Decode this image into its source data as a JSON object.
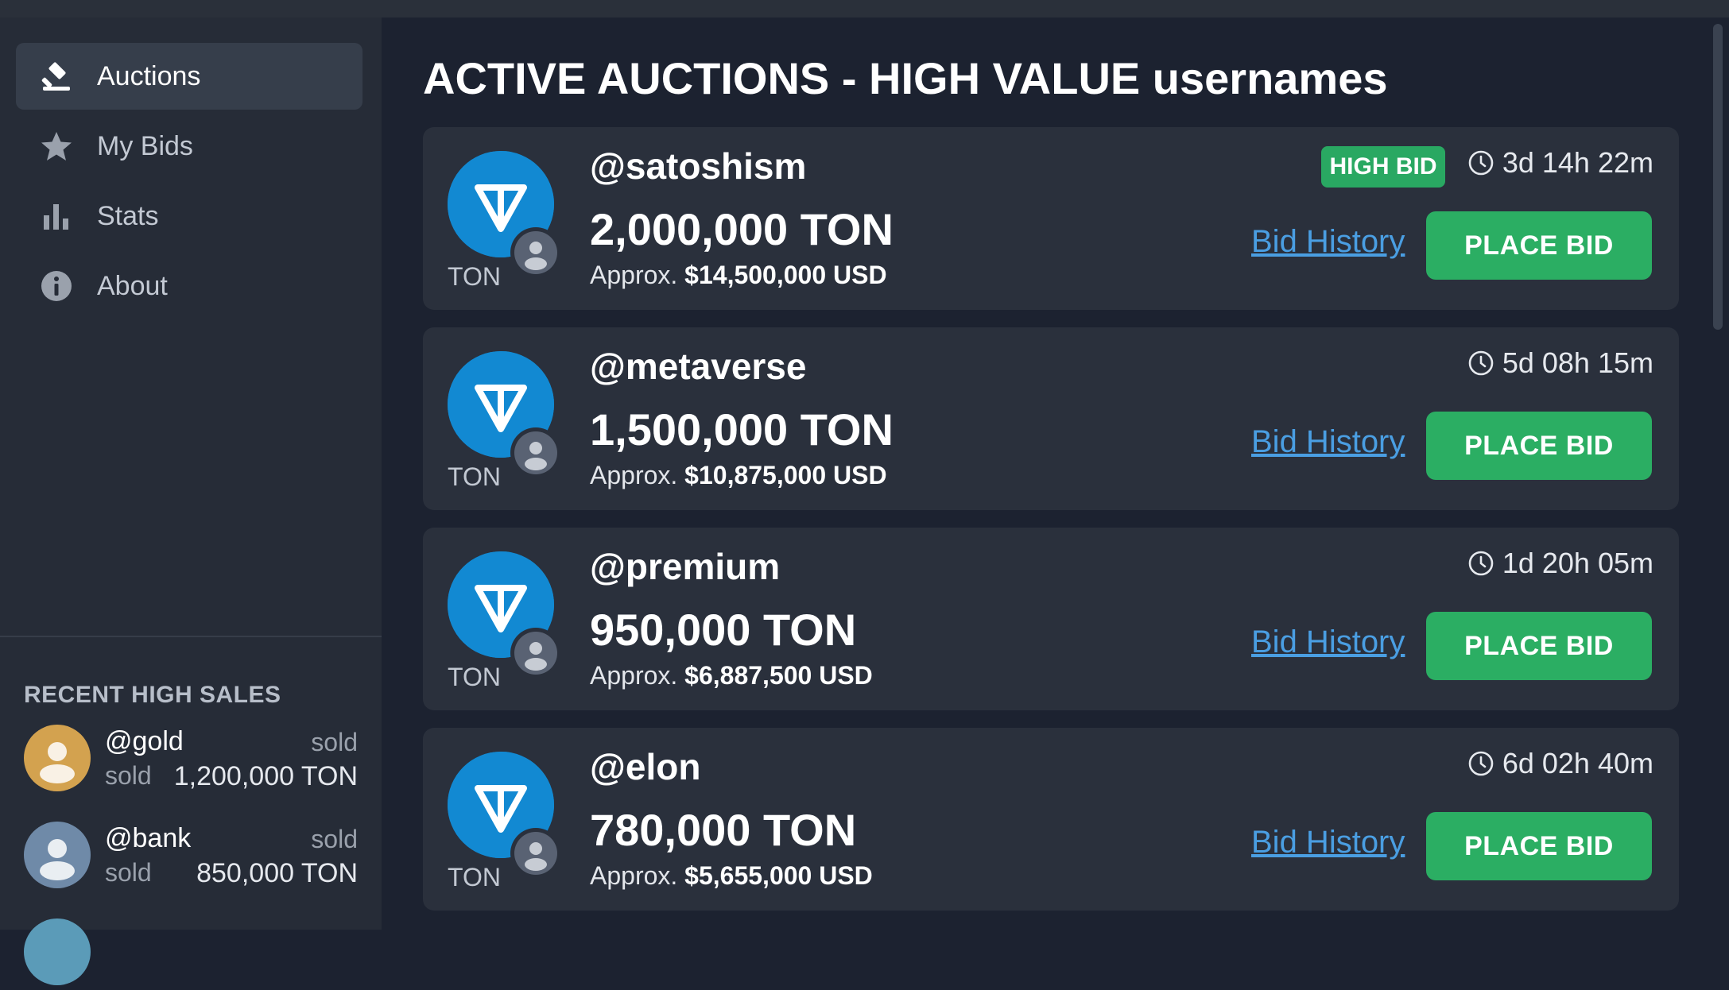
{
  "sidebar": {
    "nav": [
      {
        "label": "Auctions",
        "icon": "gavel-icon",
        "active": true
      },
      {
        "label": "My Bids",
        "icon": "star-icon",
        "active": false
      },
      {
        "label": "Stats",
        "icon": "bar-chart-icon",
        "active": false
      },
      {
        "label": "About",
        "icon": "info-icon",
        "active": false
      }
    ],
    "recent_title": "RECENT HIGH SALES",
    "recent_sales": [
      {
        "name": "@gold",
        "label1": "sold",
        "label2": "sold",
        "amount": "1,200,000 TON",
        "avatar_color": "#d3a24f"
      },
      {
        "name": "@bank",
        "label1": "sold",
        "label2": "sold",
        "amount": "850,000 TON",
        "avatar_color": "#6f8aa8"
      }
    ]
  },
  "main": {
    "title": "ACTIVE AUCTIONS - HIGH VALUE usernames",
    "auctions": [
      {
        "handle": "@satoshism",
        "price": "2,000,000 TON",
        "approx_prefix": "Approx.",
        "approx_value": "$14,500,000 USD",
        "badge": "HIGH BID",
        "timer": "3d 14h 22m",
        "coin_label": "TON",
        "history_label": "Bid History",
        "bid_label": "PLACE BID"
      },
      {
        "handle": "@metaverse",
        "price": "1,500,000 TON",
        "approx_prefix": "Approx.",
        "approx_value": "$10,875,000 USD",
        "badge": "",
        "timer": "5d 08h 15m",
        "coin_label": "TON",
        "history_label": "Bid History",
        "bid_label": "PLACE BID"
      },
      {
        "handle": "@premium",
        "price": "950,000 TON",
        "approx_prefix": "Approx.",
        "approx_value": "$6,887,500 USD",
        "badge": "",
        "timer": "1d 20h 05m",
        "coin_label": "TON",
        "history_label": "Bid History",
        "bid_label": "PLACE BID"
      },
      {
        "handle": "@elon",
        "price": "780,000 TON",
        "approx_prefix": "Approx.",
        "approx_value": "$5,655,000 USD",
        "badge": "",
        "timer": "6d 02h 40m",
        "coin_label": "TON",
        "history_label": "Bid History",
        "bid_label": "PLACE BID"
      }
    ]
  },
  "colors": {
    "accent_green": "#2bae63",
    "link_blue": "#4a9ee2",
    "ton_blue": "#1289d2",
    "sidebar_bg": "#262c37",
    "card_bg": "#2a303c"
  }
}
